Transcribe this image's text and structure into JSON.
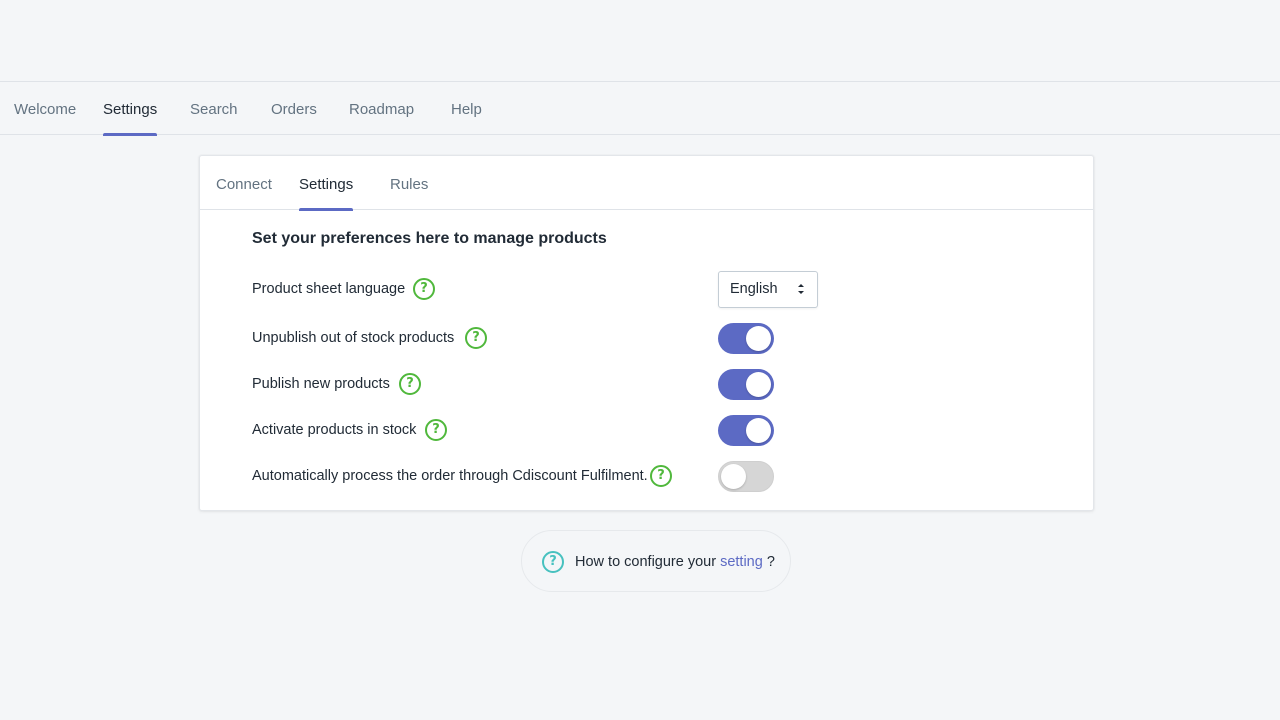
{
  "main_nav": {
    "tabs": [
      {
        "label": "Welcome",
        "active": false
      },
      {
        "label": "Settings",
        "active": true
      },
      {
        "label": "Search",
        "active": false
      },
      {
        "label": "Orders",
        "active": false
      },
      {
        "label": "Roadmap",
        "active": false
      },
      {
        "label": "Help",
        "active": false
      }
    ]
  },
  "card": {
    "tabs": [
      {
        "label": "Connect",
        "active": false
      },
      {
        "label": "Settings",
        "active": true
      },
      {
        "label": "Rules",
        "active": false
      }
    ],
    "title": "Set your preferences here to manage products",
    "rows": [
      {
        "label": "Product sheet language",
        "control": "select",
        "value": "English"
      },
      {
        "label": "Unpublish out of stock products",
        "control": "toggle",
        "on": true
      },
      {
        "label": "Publish new products",
        "control": "toggle",
        "on": true
      },
      {
        "label": "Activate products in stock",
        "control": "toggle",
        "on": true
      },
      {
        "label": "Automatically process the order through Cdiscount Fulfilment.",
        "control": "toggle",
        "on": false
      }
    ]
  },
  "footer_help": {
    "text": "How to configure your",
    "link": "setting",
    "suffix": "?"
  },
  "icons": {
    "help": "question-circle-icon",
    "select_arrows": "select-arrows-icon"
  },
  "colors": {
    "accent": "#5c6ac4",
    "help_green": "#50b83c",
    "help_teal": "#47c1bf",
    "toggle_off": "#d6d6d6"
  }
}
